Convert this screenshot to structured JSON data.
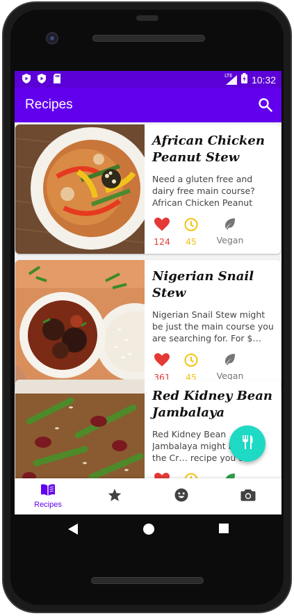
{
  "status_bar": {
    "time": "10:32",
    "network": "LTE",
    "icons": [
      "shield-play-icon",
      "shield-play-icon",
      "sd-card-icon",
      "signal-icon",
      "battery-icon"
    ]
  },
  "app_bar": {
    "title": "Recipes",
    "search_icon": "search-icon"
  },
  "colors": {
    "primary": "#6200ee",
    "status_bar": "#5b00d6",
    "fab": "#1ed9c3",
    "likes": "#e53935",
    "time": "#f4c20d",
    "vegan_leaf": "#757575"
  },
  "recipes": [
    {
      "title": "African Chicken Peanut Stew",
      "description": "Need a gluten free and dairy free main course? African Chicken Peanut Stew could …",
      "likes": "124",
      "minutes": "45",
      "diet": "Vegan"
    },
    {
      "title": "Nigerian Snail Stew",
      "description": "Nigerian Snail Stew might be just the main course you are searching for. For $…",
      "likes": "361",
      "minutes": "45",
      "diet": "Vegan"
    },
    {
      "title": "Red Kidney Bean Jambalaya",
      "description": "Red Kidney Bean Jambalaya might be just the Cr… recipe you are search… for…",
      "likes": "",
      "minutes": "",
      "diet": ""
    }
  ],
  "fab": {
    "icon": "fork-knife-icon"
  },
  "bottom_nav": {
    "items": [
      {
        "label": "Recipes",
        "icon": "book-icon",
        "selected": true
      },
      {
        "label": "",
        "icon": "star-icon",
        "selected": false
      },
      {
        "label": "",
        "icon": "smiley-icon",
        "selected": false
      },
      {
        "label": "",
        "icon": "camera-icon",
        "selected": false
      }
    ]
  },
  "system_nav": [
    "back-icon",
    "home-icon",
    "recents-icon"
  ]
}
